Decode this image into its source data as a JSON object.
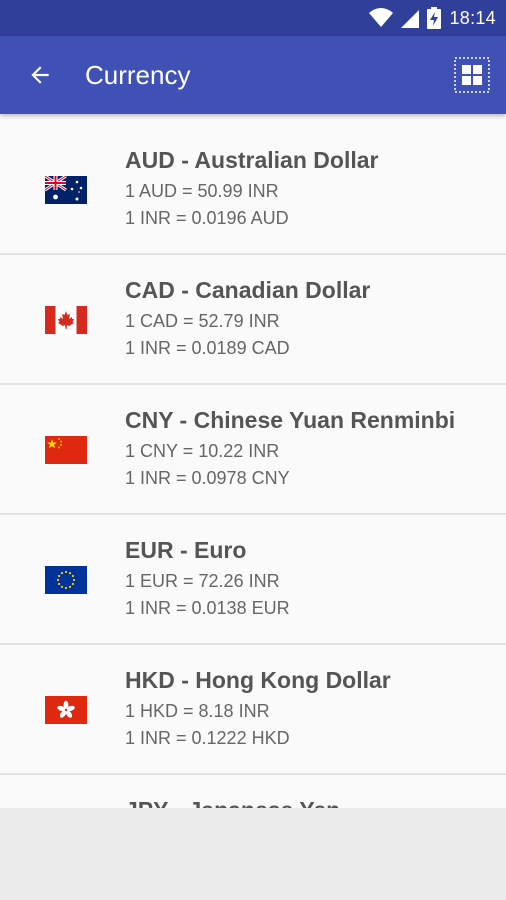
{
  "status_bar": {
    "time": "18:14"
  },
  "app_bar": {
    "title": "Currency"
  },
  "currencies": [
    {
      "name": "AUD - Australian Dollar",
      "rate": "1 AUD = 50.99 INR",
      "inverse": "1 INR = 0.0196 AUD",
      "flag_icon": "flag-australia-icon"
    },
    {
      "name": "CAD - Canadian Dollar",
      "rate": "1 CAD = 52.79 INR",
      "inverse": "1 INR = 0.0189 CAD",
      "flag_icon": "flag-canada-icon"
    },
    {
      "name": "CNY - Chinese Yuan Renminbi",
      "rate": "1 CNY = 10.22 INR",
      "inverse": "1 INR = 0.0978 CNY",
      "flag_icon": "flag-china-icon"
    },
    {
      "name": "EUR - Euro",
      "rate": "1 EUR = 72.26 INR",
      "inverse": "1 INR = 0.0138 EUR",
      "flag_icon": "flag-eu-icon"
    },
    {
      "name": "HKD - Hong Kong Dollar",
      "rate": "1 HKD = 8.18 INR",
      "inverse": "1 INR = 0.1222 HKD",
      "flag_icon": "flag-hong-kong-icon"
    },
    {
      "name": "JPY - Japanese Yen",
      "rate": "",
      "inverse": "",
      "flag_icon": "flag-japan-icon"
    }
  ],
  "colors": {
    "status_bar": "#2f3f9a",
    "app_bar": "#3f51b5",
    "list_bg": "#fafafa"
  }
}
